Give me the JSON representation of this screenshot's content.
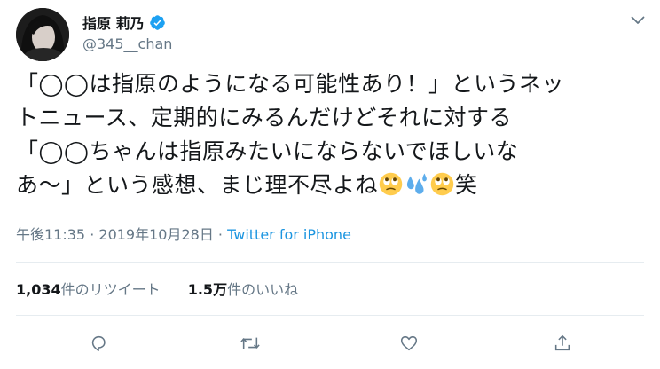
{
  "user": {
    "display_name": "指原 莉乃",
    "handle": "@345__chan",
    "verified": true
  },
  "tweet": {
    "lines": [
      "「◯◯は指原のようになる可能性あり！」というネッ",
      "トニュース、定期的にみるんだけどそれに対する",
      "「◯◯ちゃんは指原みたいにならないでほしいな",
      "あ〜」という感想、まじ理不尽よね"
    ],
    "trailing_text": "笑",
    "emojis": [
      "face-with-rolling-eyes-icon",
      "sweat-droplets-icon",
      "face-with-rolling-eyes-icon"
    ]
  },
  "meta": {
    "time": "午後11:35",
    "separator": " · ",
    "date": "2019年10月28日",
    "separator2": " · ",
    "source": "Twitter for iPhone"
  },
  "stats": {
    "retweets_count": "1,034",
    "retweets_label": "件のリツイート",
    "likes_count": "1.5万",
    "likes_label": "件のいいね"
  },
  "colors": {
    "link": "#1b95e0",
    "secondary": "#657786",
    "divider": "#e6ecf0",
    "verified": "#1da1f2"
  }
}
